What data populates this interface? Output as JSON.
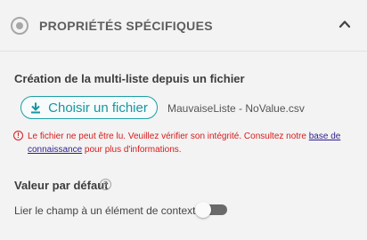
{
  "header": {
    "title": "PROPRIÉTÉS SPÉCIFIQUES",
    "icon": "radio-target-icon",
    "collapse_icon": "chevron-up-icon"
  },
  "multilist": {
    "label": "Création de la multi-liste depuis un fichier",
    "button_label": "Choisir un fichier",
    "button_icon": "download-icon",
    "file_name": "MauvaiseListe - NoValue.csv"
  },
  "error": {
    "icon_glyph": "!",
    "text_before": "Le fichier ne peut être lu. Veuillez vérifier son intégrité. Consultez notre ",
    "link_text": "base de connaissance",
    "text_after": " pour plus d'informations."
  },
  "default_value": {
    "label": "Valeur par défaut",
    "help_glyph": "?",
    "toggle_label": "Lier le champ à un élément de contexte",
    "toggle_on": false
  },
  "colors": {
    "accent": "#1b9fa6",
    "error": "#d81a1a",
    "link": "#2c1f8c",
    "background": "#f3f3f3"
  }
}
